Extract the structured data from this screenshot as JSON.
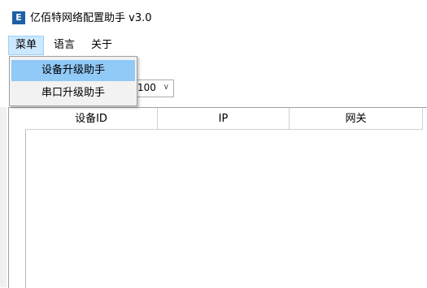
{
  "window": {
    "title": "亿佰特网络配置助手 v3.0",
    "icon_text": "E"
  },
  "menubar": {
    "items": [
      "菜单",
      "语言",
      "关于"
    ]
  },
  "dropdown": {
    "items": [
      "设备升级助手",
      "串口升级助手"
    ]
  },
  "toolbar": {
    "combo_value": "100",
    "combo_arrow": "∨"
  },
  "grid": {
    "columns": [
      "设备ID",
      "IP",
      "网关"
    ]
  },
  "colors": {
    "menu_active": "#cce8ff",
    "dropdown_highlight": "#91c9f7",
    "app_icon": "#1d5fa6"
  }
}
